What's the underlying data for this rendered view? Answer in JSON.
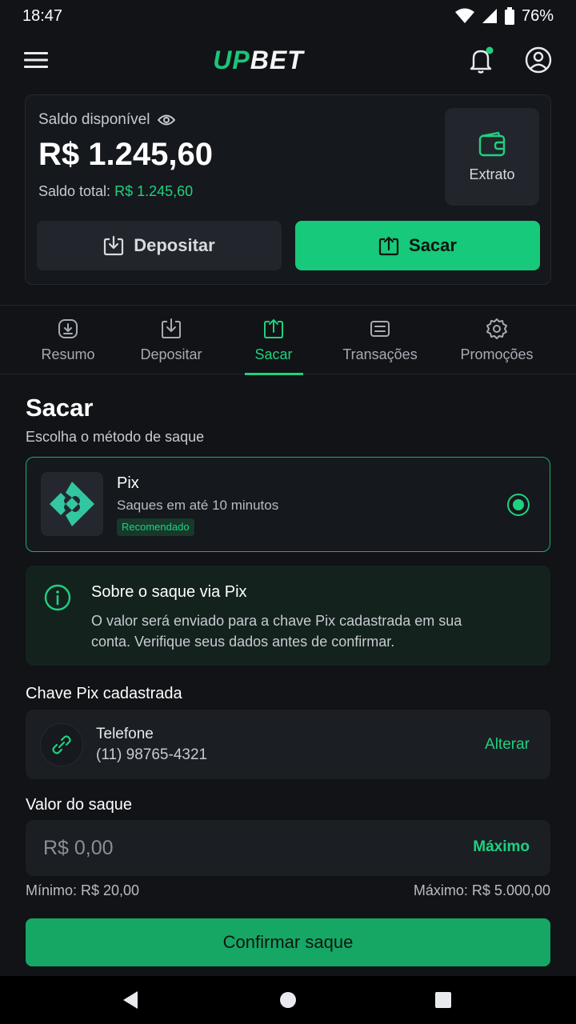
{
  "status": {
    "time": "18:47",
    "battery": "76%"
  },
  "appbar": {
    "logo_up": "UP",
    "logo_bet": "BET"
  },
  "balance": {
    "label": "Saldo disponível",
    "amount": "R$ 1.245,60",
    "total_label": "Saldo total:",
    "total_value": "R$ 1.245,60",
    "extrato_label": "Extrato",
    "deposit_label": "Depositar",
    "withdraw_label": "Sacar"
  },
  "tabs": [
    {
      "label": "Resumo",
      "icon": "summary-icon"
    },
    {
      "label": "Depositar",
      "icon": "deposit-icon"
    },
    {
      "label": "Sacar",
      "icon": "withdraw-icon",
      "active": true
    },
    {
      "label": "Transações",
      "icon": "transactions-icon"
    },
    {
      "label": "Promoções",
      "icon": "promotions-icon"
    }
  ],
  "main": {
    "title": "Sacar",
    "subtitle": "Escolha o método de saque",
    "method": {
      "name": "Pix",
      "description": "Saques em até 10 minutos",
      "badge": "Recomendado",
      "selected": true
    },
    "info": {
      "title": "Sobre o saque via Pix",
      "text": "O valor será enviado para a chave Pix cadastrada em sua conta. Verifique seus dados antes de confirmar."
    },
    "key_section": {
      "label": "Chave Pix cadastrada",
      "type": "Telefone",
      "value": "(11) 98765-4321",
      "change_label": "Alterar"
    },
    "amount_section": {
      "label": "Valor do saque",
      "placeholder": "R$ 0,00",
      "max_label": "Máximo",
      "min_text": "Mínimo: R$ 20,00",
      "max_text": "Máximo: R$ 5.000,00"
    },
    "confirm_label": "Confirmar saque"
  },
  "colors": {
    "accent": "#17c97a",
    "background": "#111317",
    "card": "#1b1e23"
  }
}
